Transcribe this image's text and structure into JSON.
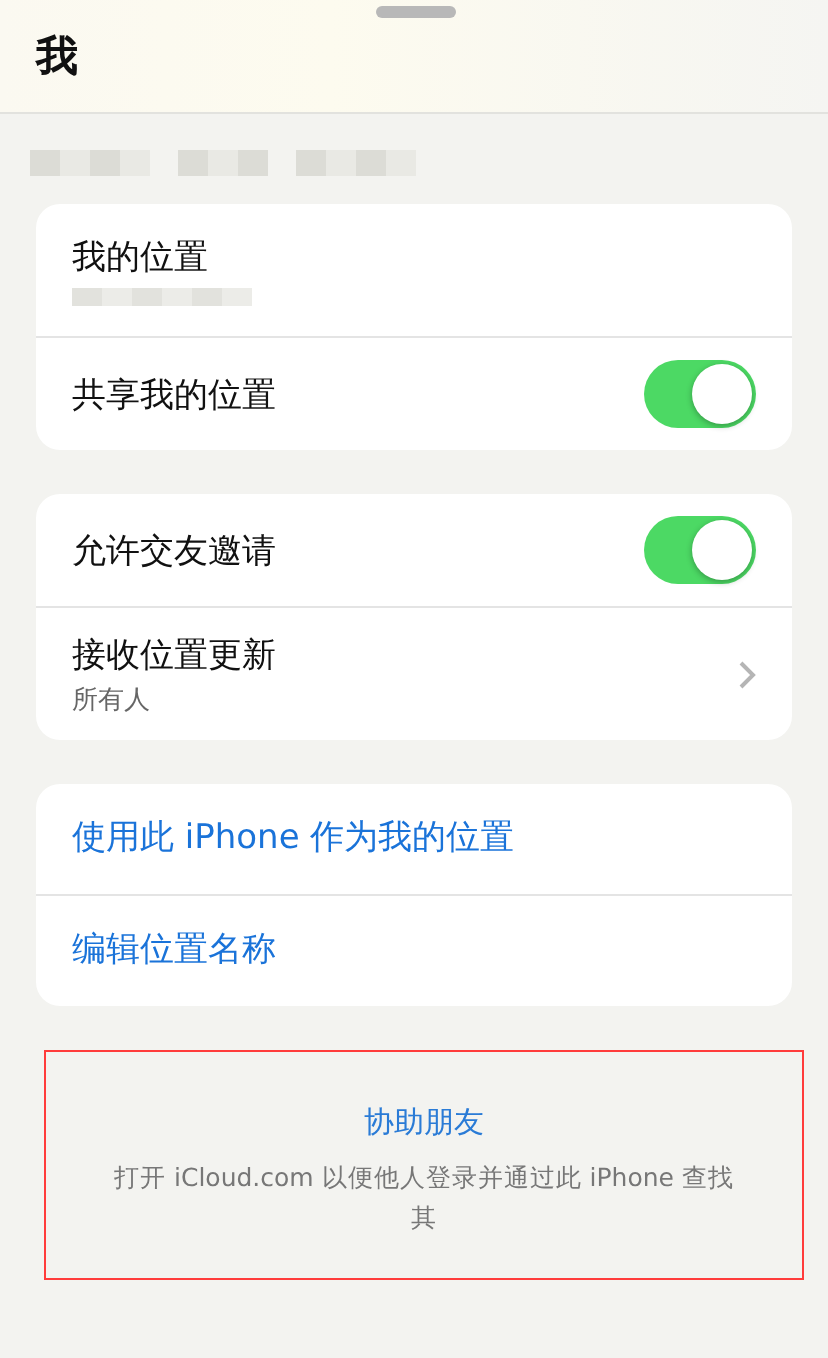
{
  "header": {
    "title": "我"
  },
  "location_card": {
    "rows": [
      {
        "kind": "info",
        "label": "我的位置"
      },
      {
        "kind": "toggle",
        "label": "共享我的位置",
        "on": true
      }
    ]
  },
  "friends_card": {
    "rows": [
      {
        "kind": "toggle",
        "label": "允许交友邀请",
        "on": true
      },
      {
        "kind": "nav",
        "label": "接收位置更新",
        "subtitle": "所有人"
      }
    ]
  },
  "actions_card": {
    "links": [
      "使用此 iPhone 作为我的位置",
      "编辑位置名称"
    ]
  },
  "help_section": {
    "title": "协助朋友",
    "lines": [
      "打开 iCloud.com 以便他人登录并通过此 iPhone 查找",
      "其"
    ]
  }
}
